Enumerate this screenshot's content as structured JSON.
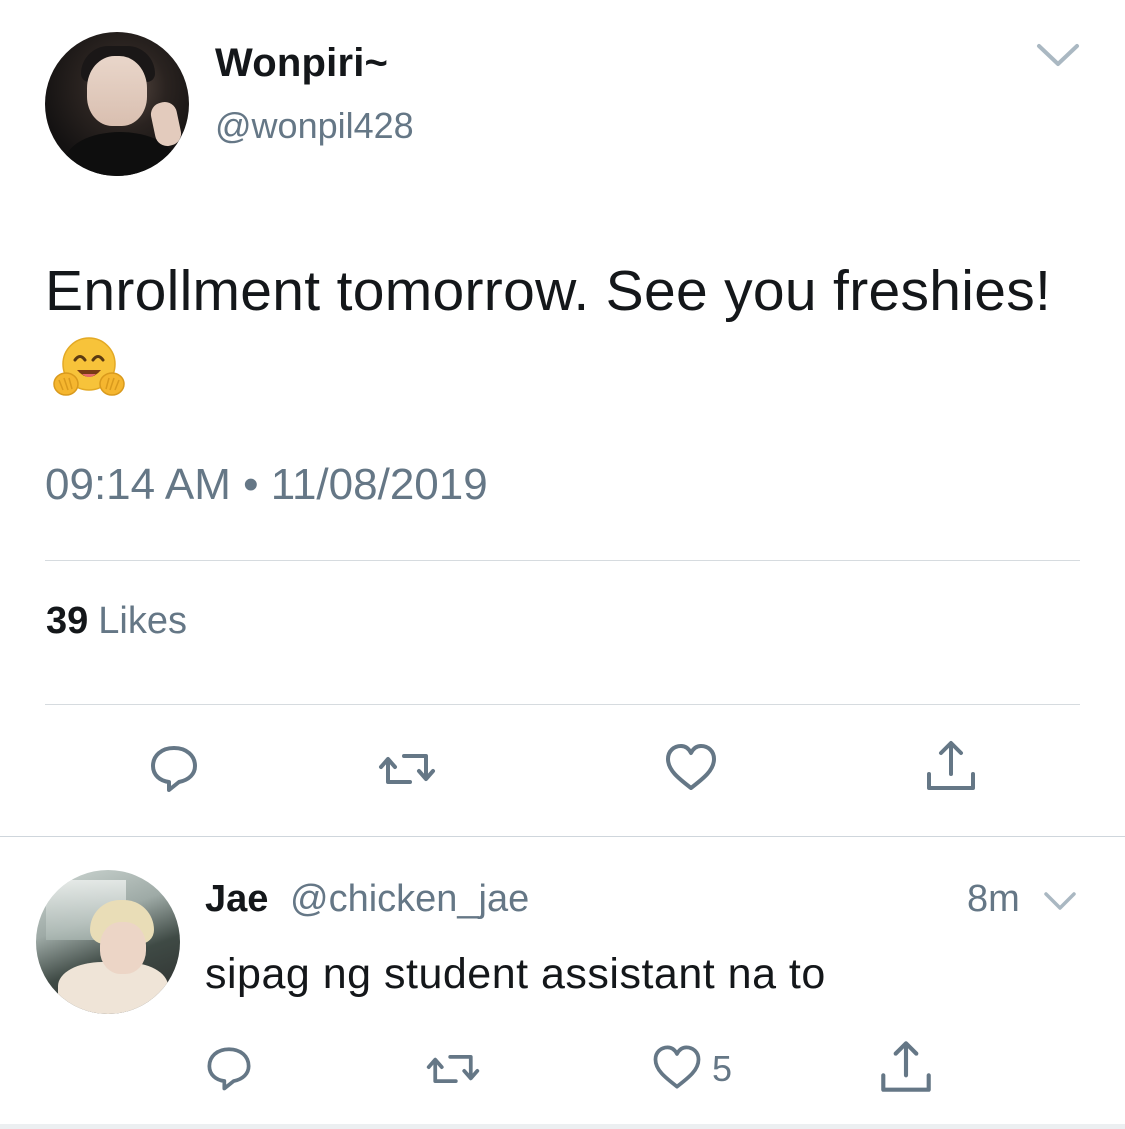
{
  "tweet": {
    "author": {
      "display_name": "Wonpiri~",
      "handle": "@wonpil428"
    },
    "text": "Enrollment tomorrow. See you freshies!",
    "emoji": "hugging-face",
    "timestamp": "09:14 AM • 11/08/2019",
    "likes_count": "39",
    "likes_label": "Likes"
  },
  "reply": {
    "author": {
      "display_name": "Jae",
      "handle": "@chicken_jae"
    },
    "time": "8m",
    "text": "sipag ng student assistant na to",
    "like_count": "5"
  },
  "colors": {
    "primary_text": "#14171a",
    "secondary_text": "#657786",
    "divider": "#d6dbdf"
  },
  "icons": [
    "chevron-down-icon",
    "reply-icon",
    "retweet-icon",
    "like-icon",
    "share-icon"
  ]
}
